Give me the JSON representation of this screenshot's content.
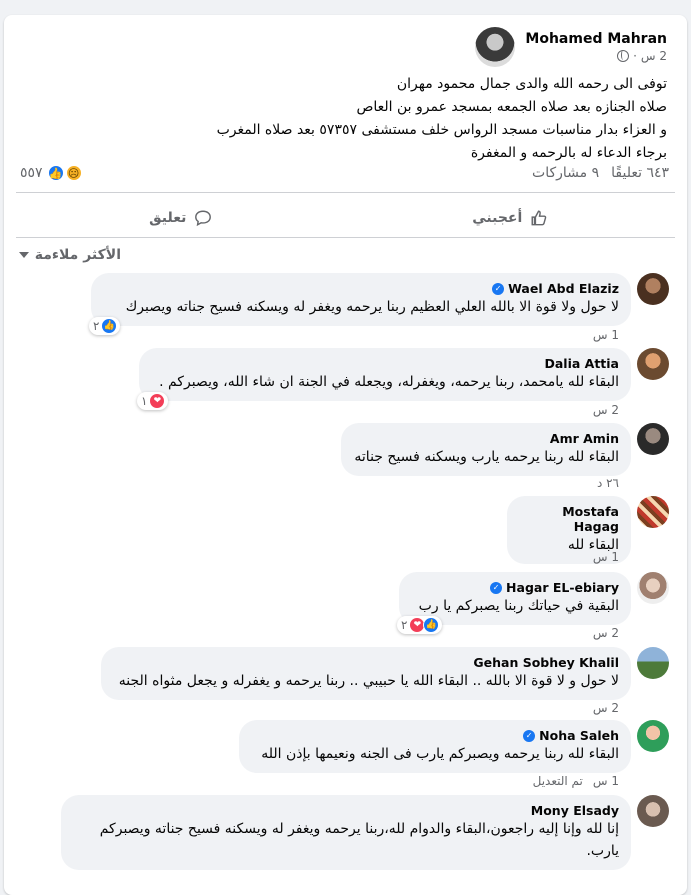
{
  "post": {
    "author": "Mohamed Mahran",
    "time": "2 س",
    "lines": [
      "توفى الى رحمه الله والدى جمال محمود مهران",
      "صلاه الجنازه بعد صلاه الجمعه بمسجد عمرو بن العاص",
      "و العزاء بدار مناسبات مسجد الرواس خلف مستشفى ٥٧٣٥٧  بعد صلاه المغرب",
      "برجاء الدعاء له بالرحمه و المغفرة"
    ],
    "reaction_count": "٥٥٧",
    "comments_count": "٦٤٣ تعليقًا",
    "shares_count": "٩ مشاركات"
  },
  "actions": {
    "like": "أعجبني",
    "comment": "تعليق"
  },
  "sort_label": "الأكثر ملاءمة",
  "comments": [
    {
      "name": "Wael Abd Elaziz",
      "verified": true,
      "text": "لا حول ولا قوة الا بالله العلي العظيم ربنا يرحمه ويغفر له ويسكنه فسيح جناته ويصبرك",
      "time": "1 س",
      "reactions": "٢",
      "reaction_types": [
        "like"
      ]
    },
    {
      "name": "Dalia Attia",
      "verified": false,
      "text": "البقاء لله يامحمد، ربنا يرحمه، ويغفرله، ويجعله في الجنة ان شاء الله، ويصبركم .",
      "time": "2 س",
      "reactions": "١",
      "reaction_types": [
        "love"
      ]
    },
    {
      "name": "Amr Amin",
      "verified": false,
      "text": "البقاء لله ربنا يرحمه يارب ويسكنه فسيح جناته",
      "time": "٢٦ د"
    },
    {
      "name": "Mostafa Hagag",
      "verified": false,
      "text": "البقاء لله",
      "time": "1 س"
    },
    {
      "name": "Hagar EL-ebiary",
      "verified": true,
      "text": "البقية في حياتك ربنا يصبركم يا رب",
      "time": "2 س",
      "reactions": "٢",
      "reaction_types": [
        "like",
        "love"
      ]
    },
    {
      "name": "Gehan Sobhey Khalil",
      "verified": false,
      "text": "لا حول و لا قوة الا بالله .. البقاء الله يا حبيبي .. ربنا يرحمه و يغفرله و يجعل مثواه الجنه",
      "time": "2 س"
    },
    {
      "name": "Noha Saleh",
      "verified": true,
      "text": "البقاء لله ربنا يرحمه ويصبركم يارب فى الجنه ونعيمها بإذن الله",
      "time": "1 س",
      "edited": "تم التعديل"
    },
    {
      "name": "Mony Elsady",
      "verified": false,
      "text": "إنا لله وإنا إليه راجعون،البقاء والدوام لله،ربنا يرحمه ويغفر له ويسكنه فسيح جناته ويصبركم يارب."
    }
  ]
}
